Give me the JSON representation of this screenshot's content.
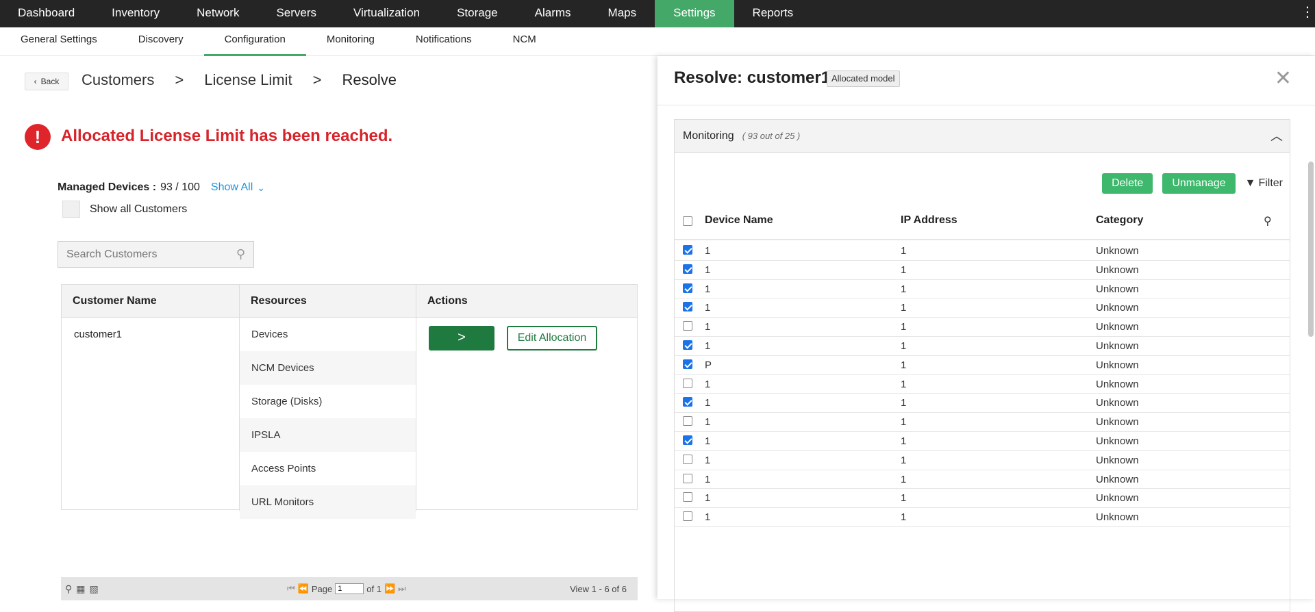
{
  "topnav": [
    "Dashboard",
    "Inventory",
    "Network",
    "Servers",
    "Virtualization",
    "Storage",
    "Alarms",
    "Maps",
    "Settings",
    "Reports"
  ],
  "subnav": [
    "General Settings",
    "Discovery",
    "Configuration",
    "Monitoring",
    "Notifications",
    "NCM"
  ],
  "back": "Back",
  "breadcrumb": {
    "c1": "Customers",
    "sep": ">",
    "c2": "License Limit",
    "c3": "Resolve"
  },
  "alert": {
    "icon": "!",
    "text": "Allocated License Limit has been reached."
  },
  "managed": {
    "label": "Managed Devices :",
    "value": "93 / 100",
    "show_all": "Show All"
  },
  "show_all_customers": "Show all Customers",
  "search": {
    "placeholder": "Search Customers"
  },
  "customer_table": {
    "headers": [
      "Customer Name",
      "Resources",
      "Actions"
    ],
    "customer": "customer1",
    "resources": [
      "Devices",
      "NCM Devices",
      "Storage (Disks)",
      "IPSLA",
      "Access Points",
      "URL Monitors"
    ],
    "go_label": ">",
    "edit_label": "Edit Allocation"
  },
  "pager": {
    "page_label": "Page",
    "page_value": "1",
    "of_label": "of 1",
    "view": "View 1 - 6 of 6"
  },
  "panel": {
    "title": "Resolve: customer1",
    "badge": "Allocated model",
    "section_title": "Monitoring",
    "section_count": "( 93 out of 25 )",
    "delete": "Delete",
    "unmanage": "Unmanage",
    "filter": "Filter",
    "columns": [
      "Device Name",
      "IP Address",
      "Category"
    ],
    "rows": [
      {
        "name": "1",
        "ip": "1",
        "cat": "Unknown",
        "checked": true
      },
      {
        "name": "1",
        "ip": "1",
        "cat": "Unknown",
        "checked": true
      },
      {
        "name": "1",
        "ip": "1",
        "cat": "Unknown",
        "checked": true
      },
      {
        "name": "1",
        "ip": "1",
        "cat": "Unknown",
        "checked": true
      },
      {
        "name": "1",
        "ip": "1",
        "cat": "Unknown",
        "checked": false
      },
      {
        "name": "1",
        "ip": "1",
        "cat": "Unknown",
        "checked": true
      },
      {
        "name": "P",
        "ip": "1",
        "cat": "Unknown",
        "checked": true
      },
      {
        "name": "1",
        "ip": "1",
        "cat": "Unknown",
        "checked": false
      },
      {
        "name": "1",
        "ip": "1",
        "cat": "Unknown",
        "checked": true
      },
      {
        "name": "1",
        "ip": "1",
        "cat": "Unknown",
        "checked": false
      },
      {
        "name": "1",
        "ip": "1",
        "cat": "Unknown",
        "checked": true
      },
      {
        "name": "1",
        "ip": "1",
        "cat": "Unknown",
        "checked": false
      },
      {
        "name": "1",
        "ip": "1",
        "cat": "Unknown",
        "checked": false
      },
      {
        "name": "1",
        "ip": "1",
        "cat": "Unknown",
        "checked": false
      },
      {
        "name": "1",
        "ip": "1",
        "cat": "Unknown",
        "checked": false
      }
    ]
  },
  "colors": {
    "accent": "#43a868",
    "alert": "#d7232a",
    "dark_green": "#1f7a3f",
    "link": "#1a94e0"
  }
}
